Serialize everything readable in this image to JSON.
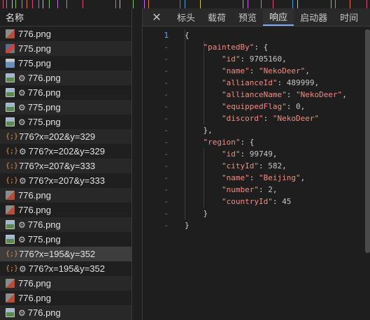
{
  "list": {
    "header": "名称",
    "rows": [
      {
        "name": "776.png",
        "icon": "png-a",
        "gear": false
      },
      {
        "name": "775.png",
        "icon": "png-b",
        "gear": false
      },
      {
        "name": "775.png",
        "icon": "png-c",
        "gear": false
      },
      {
        "name": "776.png",
        "icon": "img",
        "gear": true
      },
      {
        "name": "776.png",
        "icon": "img",
        "gear": true
      },
      {
        "name": "775.png",
        "icon": "img",
        "gear": true
      },
      {
        "name": "775.png",
        "icon": "img",
        "gear": true
      },
      {
        "name": "776?x=202&y=329",
        "icon": "json",
        "gear": false
      },
      {
        "name": "776?x=202&y=329",
        "icon": "json",
        "gear": true
      },
      {
        "name": "776?x=207&y=333",
        "icon": "json",
        "gear": false
      },
      {
        "name": "776?x=207&y=333",
        "icon": "json",
        "gear": true
      },
      {
        "name": "776.png",
        "icon": "png-a",
        "gear": false
      },
      {
        "name": "776.png",
        "icon": "png-a",
        "gear": false
      },
      {
        "name": "776.png",
        "icon": "img",
        "gear": true
      },
      {
        "name": "775.png",
        "icon": "img",
        "gear": true
      },
      {
        "name": "776?x=195&y=352",
        "icon": "json",
        "gear": false,
        "selected": true
      },
      {
        "name": "776?x=195&y=352",
        "icon": "json",
        "gear": true
      },
      {
        "name": "776.png",
        "icon": "png-a",
        "gear": false
      },
      {
        "name": "776.png",
        "icon": "png-a",
        "gear": false
      },
      {
        "name": "776.png",
        "icon": "img",
        "gear": true
      }
    ]
  },
  "panel": {
    "close_icon": "close-icon",
    "tabs": [
      {
        "label": "标头",
        "active": false
      },
      {
        "label": "载荷",
        "active": false
      },
      {
        "label": "预览",
        "active": false
      },
      {
        "label": "响应",
        "active": true
      },
      {
        "label": "启动器",
        "active": false
      },
      {
        "label": "时间",
        "active": false
      }
    ]
  },
  "response": {
    "line_numbers": [
      "1",
      "-",
      "-",
      "-",
      "-",
      "-",
      "-",
      "-",
      "-",
      "-",
      "-",
      "-",
      "-",
      "-",
      "-",
      "-",
      "-"
    ],
    "lines": [
      [
        {
          "t": "{",
          "c": "p"
        }
      ],
      [
        {
          "t": "    ",
          "c": "p"
        },
        {
          "t": "\"paintedBy\"",
          "c": "k"
        },
        {
          "t": ": {",
          "c": "p"
        }
      ],
      [
        {
          "t": "        ",
          "c": "p"
        },
        {
          "t": "\"id\"",
          "c": "k"
        },
        {
          "t": ": ",
          "c": "p"
        },
        {
          "t": "9705160",
          "c": "n"
        },
        {
          "t": ",",
          "c": "p"
        }
      ],
      [
        {
          "t": "        ",
          "c": "p"
        },
        {
          "t": "\"name\"",
          "c": "k"
        },
        {
          "t": ": ",
          "c": "p"
        },
        {
          "t": "\"NekoDeer\"",
          "c": "s"
        },
        {
          "t": ",",
          "c": "p"
        }
      ],
      [
        {
          "t": "        ",
          "c": "p"
        },
        {
          "t": "\"allianceId\"",
          "c": "k"
        },
        {
          "t": ": ",
          "c": "p"
        },
        {
          "t": "489999",
          "c": "n"
        },
        {
          "t": ",",
          "c": "p"
        }
      ],
      [
        {
          "t": "        ",
          "c": "p"
        },
        {
          "t": "\"allianceName\"",
          "c": "k"
        },
        {
          "t": ": ",
          "c": "p"
        },
        {
          "t": "\"NekoDeer\"",
          "c": "s"
        },
        {
          "t": ",",
          "c": "p"
        }
      ],
      [
        {
          "t": "        ",
          "c": "p"
        },
        {
          "t": "\"equippedFlag\"",
          "c": "k"
        },
        {
          "t": ": ",
          "c": "p"
        },
        {
          "t": "0",
          "c": "n"
        },
        {
          "t": ",",
          "c": "p"
        }
      ],
      [
        {
          "t": "        ",
          "c": "p"
        },
        {
          "t": "\"discord\"",
          "c": "k"
        },
        {
          "t": ": ",
          "c": "p"
        },
        {
          "t": "\"NekoDeer\"",
          "c": "s"
        }
      ],
      [
        {
          "t": "    },",
          "c": "p"
        }
      ],
      [
        {
          "t": "    ",
          "c": "p"
        },
        {
          "t": "\"region\"",
          "c": "k"
        },
        {
          "t": ": {",
          "c": "p"
        }
      ],
      [
        {
          "t": "        ",
          "c": "p"
        },
        {
          "t": "\"id\"",
          "c": "k"
        },
        {
          "t": ": ",
          "c": "p"
        },
        {
          "t": "99749",
          "c": "n"
        },
        {
          "t": ",",
          "c": "p"
        }
      ],
      [
        {
          "t": "        ",
          "c": "p"
        },
        {
          "t": "\"cityId\"",
          "c": "k"
        },
        {
          "t": ": ",
          "c": "p"
        },
        {
          "t": "582",
          "c": "n"
        },
        {
          "t": ",",
          "c": "p"
        }
      ],
      [
        {
          "t": "        ",
          "c": "p"
        },
        {
          "t": "\"name\"",
          "c": "k"
        },
        {
          "t": ": ",
          "c": "p"
        },
        {
          "t": "\"Beijing\"",
          "c": "s"
        },
        {
          "t": ",",
          "c": "p"
        }
      ],
      [
        {
          "t": "        ",
          "c": "p"
        },
        {
          "t": "\"number\"",
          "c": "k"
        },
        {
          "t": ": ",
          "c": "p"
        },
        {
          "t": "2",
          "c": "n"
        },
        {
          "t": ",",
          "c": "p"
        }
      ],
      [
        {
          "t": "        ",
          "c": "p"
        },
        {
          "t": "\"countryId\"",
          "c": "k"
        },
        {
          "t": ": ",
          "c": "p"
        },
        {
          "t": "45",
          "c": "n"
        }
      ],
      [
        {
          "t": "    }",
          "c": "p"
        }
      ],
      [
        {
          "t": "}",
          "c": "p"
        }
      ]
    ]
  }
}
